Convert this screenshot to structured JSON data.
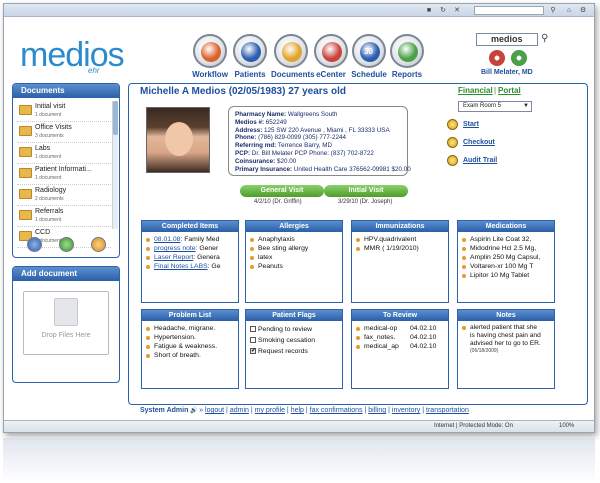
{
  "browser": {
    "status_zone": "Internet | Protected Mode: On",
    "zoom": "100%"
  },
  "app": {
    "logo": "medios",
    "logo_sub": "ehr"
  },
  "nav": [
    {
      "label": "Workflow",
      "icon": "workflow-icon",
      "color": "#d8632a"
    },
    {
      "label": "Patients",
      "icon": "patients-icon",
      "color": "#2a5fb0"
    },
    {
      "label": "Documents",
      "icon": "documents-icon",
      "color": "#e0a42e"
    },
    {
      "label": "eCenter",
      "icon": "mail-icon",
      "color": "#c7433b"
    },
    {
      "label": "Schedule",
      "icon": "calendar-icon",
      "color": "#2a5fb0",
      "badge": "30"
    },
    {
      "label": "Reports",
      "icon": "reports-icon",
      "color": "#4aa14a"
    }
  ],
  "header": {
    "search_value": "medios",
    "user_name": "Bill Melater, MD"
  },
  "sidebar": {
    "documents_title": "Documents",
    "documents": [
      {
        "name": "Initial visit",
        "count": "1 document"
      },
      {
        "name": "Office Visits",
        "count": "3 documents"
      },
      {
        "name": "Labs",
        "count": "1 document"
      },
      {
        "name": "Patient Informati...",
        "count": "1 document"
      },
      {
        "name": "Radiology",
        "count": "2 documents"
      },
      {
        "name": "Referrals",
        "count": "1 document"
      },
      {
        "name": "CCD",
        "count": "1 documents"
      }
    ],
    "add_title": "Add document",
    "drop_text": "Drop Files Here"
  },
  "patient": {
    "name_line": "Michelle A Medios (02/05/1983) 27 years old",
    "info": [
      {
        "label": "Pharmacy Name:",
        "value": " Wallgreens South"
      },
      {
        "label": "Medios #:",
        "value": " 652249"
      },
      {
        "label": "Address:",
        "value": " 125 SW 220 Avenue , Miami , FL 33333 USA"
      },
      {
        "label": "Phone:",
        "value": " (786) 829-0099 (305) 777-2244"
      },
      {
        "label": "Referring md:",
        "value": " Terrence Barry, MD"
      },
      {
        "label": "PCP:",
        "value": " Dr. Bill Melater PCP Phone: (837) 702-8722"
      },
      {
        "label": "Coinsurance:",
        "value": " $20.00"
      },
      {
        "label": "Primary Insurance:",
        "value": " United Health Care 376562-09981 $20.00"
      }
    ]
  },
  "right_panel": {
    "financial": "Financial",
    "separator": "|",
    "portal": "Portal",
    "room": "Exam Room 5",
    "actions": [
      "Start",
      "Checkout",
      "Audit Trail"
    ]
  },
  "visits": [
    {
      "label": "General Visit",
      "date": "4/2/10 (Dr. Griffin)"
    },
    {
      "label": "Initial Visit",
      "date": "3/29/10 (Dr. Joseph)"
    }
  ],
  "cards": {
    "completed": {
      "title": "Completed Items",
      "rows": [
        {
          "link": "08.01.08",
          "text": ": Family Med"
        },
        {
          "link": "progress note",
          "text": ": Gener"
        },
        {
          "link": "Laser Report",
          "text": ": Genera"
        },
        {
          "link": "Final Notes LABS",
          "text": ": Ge"
        }
      ]
    },
    "allergies": {
      "title": "Allergies",
      "rows": [
        "Anaphylaxis",
        "Bee sting allergy",
        "latex",
        "Peanuts"
      ]
    },
    "immunizations": {
      "title": "Immunizations",
      "rows": [
        "HPV.quadrivalent",
        "MMR ( 1/19/2010)"
      ]
    },
    "medications": {
      "title": "Medications",
      "rows": [
        "Aspirin Lite Coat 32,",
        "Midodrine Hcl 2.5 Mg,",
        "Amplin 250 Mg Capsul,",
        "Voltaren-xr 100 Mg T",
        "Lipitor 10 Mg Tablet"
      ]
    },
    "problems": {
      "title": "Problem List",
      "rows": [
        "Headache, migrane.",
        "Hypertension.",
        "Fatigue & weakness.",
        "Short of breath."
      ]
    },
    "flags": {
      "title": "Patient Flags",
      "rows": [
        {
          "text": "Pending to review",
          "checked": false
        },
        {
          "text": "Smoking cessation",
          "checked": false
        },
        {
          "text": "Request records",
          "checked": true
        }
      ]
    },
    "review": {
      "title": "To Review",
      "rows": [
        {
          "name": "medical-op",
          "date": "04.02.10"
        },
        {
          "name": "fax_notes.",
          "date": "04.02.10"
        },
        {
          "name": "medical_ap",
          "date": "04.02.10"
        }
      ]
    },
    "notes": {
      "title": "Notes",
      "lines": [
        "alerted patient that she",
        "is having chest pain and",
        "advised her to go to ER."
      ],
      "date": "(06/18/2009)"
    }
  },
  "footer": {
    "admin": "System Admin",
    "links": [
      "logout",
      "admin",
      "my profile",
      "help",
      "fax confirmations",
      "billing",
      "inventory",
      "transportation"
    ]
  }
}
